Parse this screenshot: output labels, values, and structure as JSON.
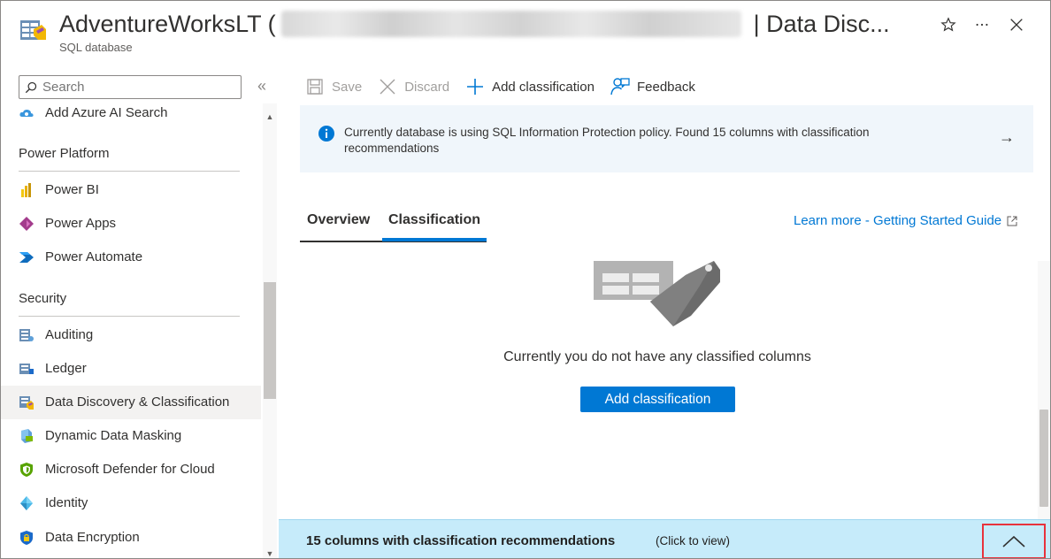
{
  "header": {
    "title_main": "AdventureWorksLT (",
    "title_blade": "| Data Disc...",
    "subtitle": "SQL database",
    "pin_icon": "star-icon",
    "more_icon": "ellipsis-icon",
    "close_icon": "close-icon"
  },
  "sidebar": {
    "search_placeholder": "Search",
    "collapse_glyph": "«",
    "items": [
      {
        "label": "Add Azure AI Search",
        "icon": "cloud-search-icon"
      },
      {
        "label": "Power BI",
        "icon": "power-bi-icon"
      },
      {
        "label": "Power Apps",
        "icon": "power-apps-icon"
      },
      {
        "label": "Power Automate",
        "icon": "power-automate-icon"
      },
      {
        "label": "Auditing",
        "icon": "auditing-icon"
      },
      {
        "label": "Ledger",
        "icon": "ledger-icon"
      },
      {
        "label": "Data Discovery & Classification",
        "icon": "data-discovery-icon",
        "active": true
      },
      {
        "label": "Dynamic Data Masking",
        "icon": "data-masking-icon"
      },
      {
        "label": "Microsoft Defender for Cloud",
        "icon": "defender-icon"
      },
      {
        "label": "Identity",
        "icon": "identity-icon"
      },
      {
        "label": "Data Encryption",
        "icon": "encryption-shield-icon"
      }
    ],
    "sections": {
      "power_platform": "Power Platform",
      "security": "Security"
    }
  },
  "toolbar": {
    "save_label": "Save",
    "discard_label": "Discard",
    "add_label": "Add classification",
    "feedback_label": "Feedback"
  },
  "info": {
    "text": "Currently database is using SQL Information Protection policy. Found 15 columns with classification recommendations",
    "arrow": "→"
  },
  "tabs": {
    "overview": "Overview",
    "classification": "Classification"
  },
  "learn_more": "Learn more - Getting Started Guide",
  "empty_state": {
    "message": "Currently you do not have any classified columns",
    "button": "Add classification"
  },
  "recommendations": {
    "title": "15 columns with classification recommendations",
    "hint": "(Click to view)"
  },
  "colors": {
    "accent": "#0078d4",
    "info_bg": "#f0f6fb",
    "rec_bar_bg": "#c6ebfa",
    "highlight_border": "#e8323c"
  }
}
